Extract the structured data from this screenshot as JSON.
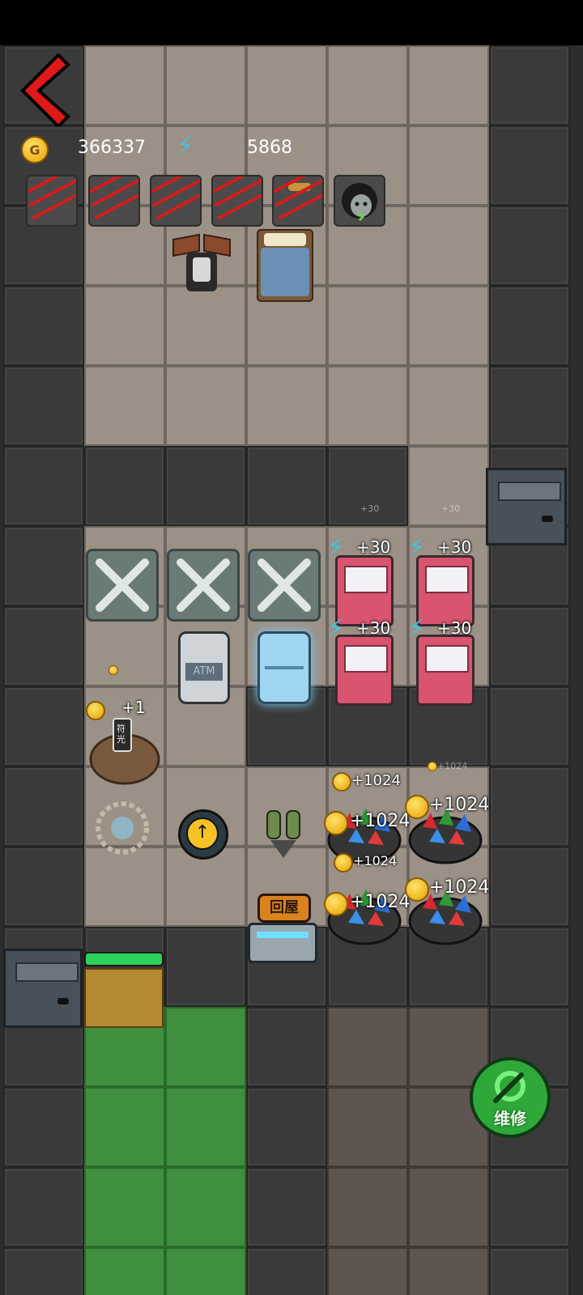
{
  "hud": {
    "coins": "366337",
    "energy": "5868",
    "coin_icon_letter": "G"
  },
  "buttons": {
    "home_label": "回屋",
    "repair_label": "维修"
  },
  "labels": {
    "energy_gain": "+30",
    "coin_gain": "+1024",
    "coin_gain_small": "+1",
    "faint_energy": "+30",
    "faint_coin": "+1024",
    "atm_text": "ATM",
    "tomb_text": "符光"
  },
  "colors": {
    "back_arrow": "#e01818",
    "repair_button": "#2fa83a",
    "home_button": "#d9831f",
    "grass": "#3f8f3e",
    "floor": "#9b9187",
    "wall": "#3a3a3a"
  },
  "icons": {
    "back": "back-arrow-icon",
    "coin": "coin-icon",
    "energy": "lightning-icon",
    "repair": "wrench-gear-icon",
    "upgrade": "upgrade-arrow-icon"
  }
}
